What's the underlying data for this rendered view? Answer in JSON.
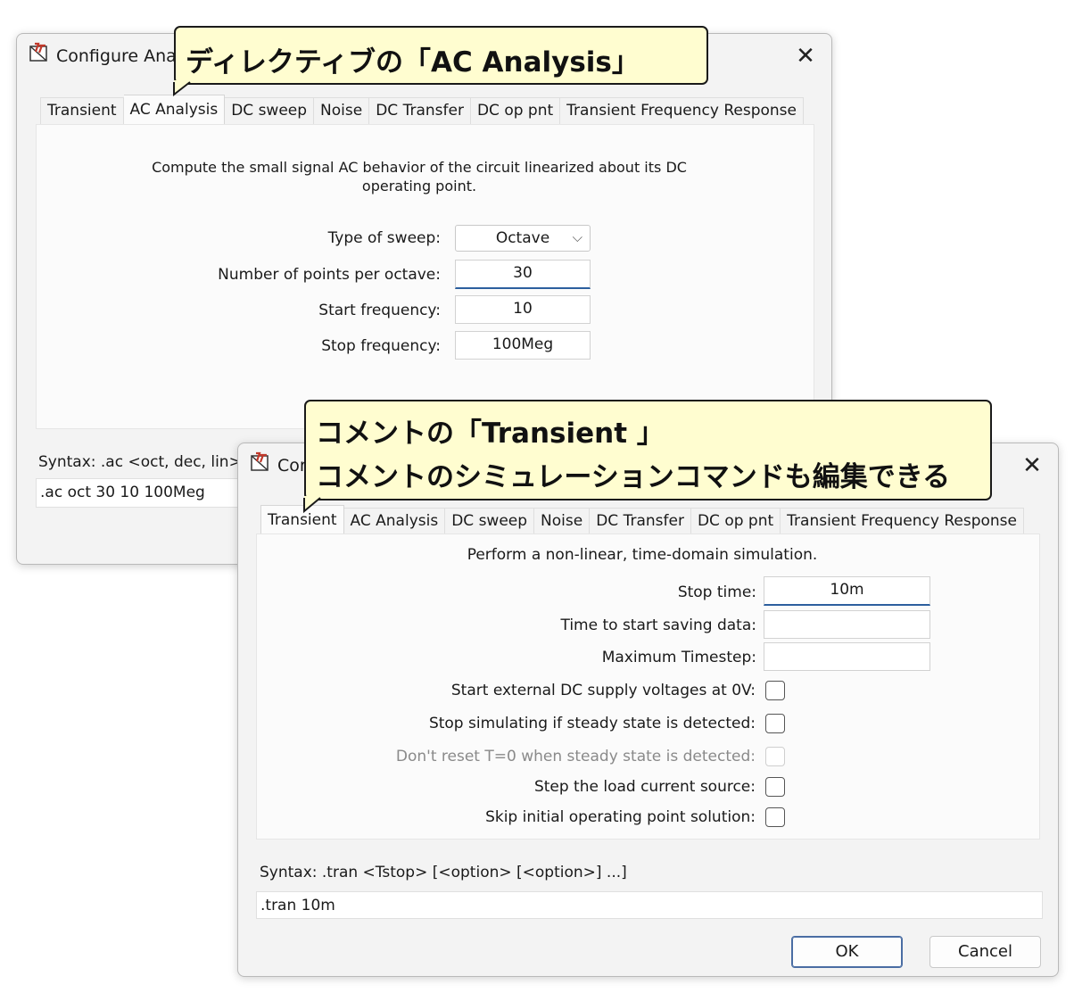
{
  "callouts": {
    "directive": "ディレクティブの「AC Analysis」",
    "comment_line1": "コメントの「Transient 」",
    "comment_line2": "コメントのシミュレーションコマンドも編集できる"
  },
  "colors": {
    "callout_fill": "#fffdd0",
    "dialog_bg": "#f3f3f3",
    "panel_bg": "#fbfbfb",
    "focus_underline": "#2c5f9e"
  },
  "dialog_back": {
    "title": "Configure Anal",
    "icon": "ltspice-icon",
    "tabs": [
      {
        "label": "Transient",
        "active": false
      },
      {
        "label": "AC Analysis",
        "active": true
      },
      {
        "label": "DC sweep",
        "active": false
      },
      {
        "label": "Noise",
        "active": false
      },
      {
        "label": "DC Transfer",
        "active": false
      },
      {
        "label": "DC op pnt",
        "active": false
      },
      {
        "label": "Transient Frequency Response",
        "active": false
      }
    ],
    "description_line1": "Compute the small signal AC behavior of the circuit linearized about its DC",
    "description_line2": "operating point.",
    "fields": {
      "sweep_type": {
        "label": "Type of sweep:",
        "value": "Octave"
      },
      "points": {
        "label": "Number of points per octave:",
        "value": "30"
      },
      "start_freq": {
        "label": "Start frequency:",
        "value": "10"
      },
      "stop_freq": {
        "label": "Stop frequency:",
        "value": "100Meg"
      }
    },
    "syntax": "Syntax:  .ac <oct, dec, lin>",
    "command": ".ac oct 30 10 100Meg"
  },
  "dialog_front": {
    "title": "Cor",
    "icon": "ltspice-icon",
    "tabs": [
      {
        "label": "Transient",
        "active": true
      },
      {
        "label": "AC Analysis",
        "active": false
      },
      {
        "label": "DC sweep",
        "active": false
      },
      {
        "label": "Noise",
        "active": false
      },
      {
        "label": "DC Transfer",
        "active": false
      },
      {
        "label": "DC op pnt",
        "active": false
      },
      {
        "label": "Transient Frequency Response",
        "active": false
      }
    ],
    "description": "Perform a non-linear, time-domain simulation.",
    "fields": {
      "stop_time": {
        "label": "Stop time:",
        "value": "10m"
      },
      "start_saving": {
        "label": "Time to start saving data:",
        "value": ""
      },
      "max_timestep": {
        "label": "Maximum Timestep:",
        "value": ""
      }
    },
    "checkboxes": [
      {
        "label": "Start external DC supply voltages at 0V:",
        "checked": false,
        "enabled": true
      },
      {
        "label": "Stop simulating if steady state is detected:",
        "checked": false,
        "enabled": true
      },
      {
        "label": "Don't reset T=0 when steady state is detected:",
        "checked": false,
        "enabled": false
      },
      {
        "label": "Step the load current source:",
        "checked": false,
        "enabled": true
      },
      {
        "label": "Skip initial operating point solution:",
        "checked": false,
        "enabled": true
      }
    ],
    "syntax": "Syntax:  .tran <Tstop> [<option> [<option>] ...]",
    "command": ".tran 10m",
    "ok_label": "OK",
    "cancel_label": "Cancel"
  }
}
